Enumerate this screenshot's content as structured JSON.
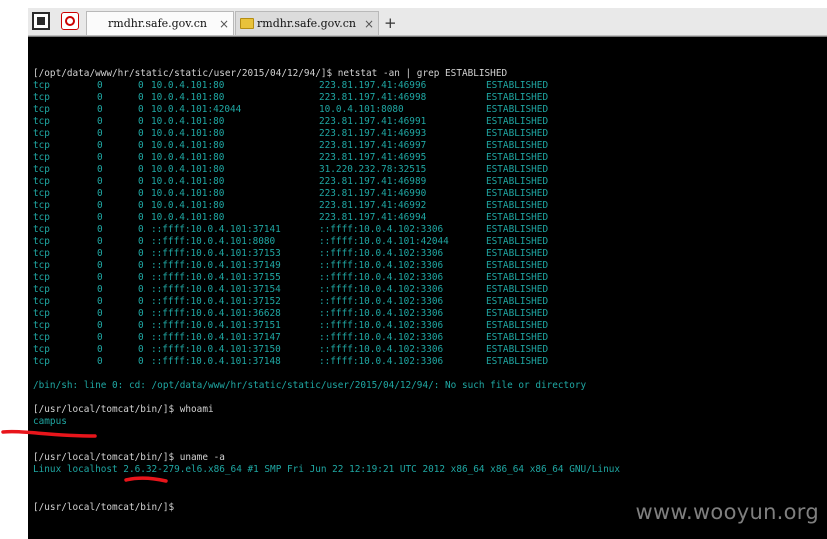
{
  "browser": {
    "tabs": [
      {
        "label": "rmdhr.safe.gov.cn",
        "active": true,
        "icon": "terminal-icon"
      },
      {
        "label": "rmdhr.safe.gov.cn",
        "active": false,
        "icon": "folder-icon"
      }
    ],
    "close_glyph": "×",
    "new_tab_glyph": "+"
  },
  "terminal": {
    "netstat_prompt": "[/opt/data/www/hr/static/static/user/2015/04/12/94/]$ netstat -an | grep ESTABLISHED",
    "connections": [
      [
        "tcp",
        "0",
        "0",
        "10.0.4.101:80",
        "223.81.197.41:46996",
        "ESTABLISHED"
      ],
      [
        "tcp",
        "0",
        "0",
        "10.0.4.101:80",
        "223.81.197.41:46998",
        "ESTABLISHED"
      ],
      [
        "tcp",
        "0",
        "0",
        "10.0.4.101:42044",
        "10.0.4.101:8080",
        "ESTABLISHED"
      ],
      [
        "tcp",
        "0",
        "0",
        "10.0.4.101:80",
        "223.81.197.41:46991",
        "ESTABLISHED"
      ],
      [
        "tcp",
        "0",
        "0",
        "10.0.4.101:80",
        "223.81.197.41:46993",
        "ESTABLISHED"
      ],
      [
        "tcp",
        "0",
        "0",
        "10.0.4.101:80",
        "223.81.197.41:46997",
        "ESTABLISHED"
      ],
      [
        "tcp",
        "0",
        "0",
        "10.0.4.101:80",
        "223.81.197.41:46995",
        "ESTABLISHED"
      ],
      [
        "tcp",
        "0",
        "0",
        "10.0.4.101:80",
        "31.220.232.78:32515",
        "ESTABLISHED"
      ],
      [
        "tcp",
        "0",
        "0",
        "10.0.4.101:80",
        "223.81.197.41:46989",
        "ESTABLISHED"
      ],
      [
        "tcp",
        "0",
        "0",
        "10.0.4.101:80",
        "223.81.197.41:46990",
        "ESTABLISHED"
      ],
      [
        "tcp",
        "0",
        "0",
        "10.0.4.101:80",
        "223.81.197.41:46992",
        "ESTABLISHED"
      ],
      [
        "tcp",
        "0",
        "0",
        "10.0.4.101:80",
        "223.81.197.41:46994",
        "ESTABLISHED"
      ],
      [
        "tcp",
        "0",
        "0",
        "::ffff:10.0.4.101:37141",
        "::ffff:10.0.4.102:3306",
        "ESTABLISHED"
      ],
      [
        "tcp",
        "0",
        "0",
        "::ffff:10.0.4.101:8080",
        "::ffff:10.0.4.101:42044",
        "ESTABLISHED"
      ],
      [
        "tcp",
        "0",
        "0",
        "::ffff:10.0.4.101:37153",
        "::ffff:10.0.4.102:3306",
        "ESTABLISHED"
      ],
      [
        "tcp",
        "0",
        "0",
        "::ffff:10.0.4.101:37149",
        "::ffff:10.0.4.102:3306",
        "ESTABLISHED"
      ],
      [
        "tcp",
        "0",
        "0",
        "::ffff:10.0.4.101:37155",
        "::ffff:10.0.4.102:3306",
        "ESTABLISHED"
      ],
      [
        "tcp",
        "0",
        "0",
        "::ffff:10.0.4.101:37154",
        "::ffff:10.0.4.102:3306",
        "ESTABLISHED"
      ],
      [
        "tcp",
        "0",
        "0",
        "::ffff:10.0.4.101:37152",
        "::ffff:10.0.4.102:3306",
        "ESTABLISHED"
      ],
      [
        "tcp",
        "0",
        "0",
        "::ffff:10.0.4.101:36628",
        "::ffff:10.0.4.102:3306",
        "ESTABLISHED"
      ],
      [
        "tcp",
        "0",
        "0",
        "::ffff:10.0.4.101:37151",
        "::ffff:10.0.4.102:3306",
        "ESTABLISHED"
      ],
      [
        "tcp",
        "0",
        "0",
        "::ffff:10.0.4.101:37147",
        "::ffff:10.0.4.102:3306",
        "ESTABLISHED"
      ],
      [
        "tcp",
        "0",
        "0",
        "::ffff:10.0.4.101:37150",
        "::ffff:10.0.4.102:3306",
        "ESTABLISHED"
      ],
      [
        "tcp",
        "0",
        "0",
        "::ffff:10.0.4.101:37148",
        "::ffff:10.0.4.102:3306",
        "ESTABLISHED"
      ]
    ],
    "error_line": "/bin/sh: line 0: cd: /opt/data/www/hr/static/static/user/2015/04/12/94/: No such file or directory",
    "whoami_prompt": "[/usr/local/tomcat/bin/]$ whoami",
    "whoami_output": "campus",
    "uname_prompt": "[/usr/local/tomcat/bin/]$ uname -a",
    "uname_output": "Linux localhost 2.6.32-279.el6.x86_64 #1 SMP Fri Jun 22 12:19:21 UTC 2012 x86_64 x86_64 x86_64 GNU/Linux",
    "final_prompt": "[/usr/local/tomcat/bin/]$"
  },
  "watermark": "www.wooyun.org",
  "colors": {
    "terminal_bg": "#000000",
    "terminal_text": "#1fa7a3",
    "prompt_text": "#d2d2d2",
    "annotation": "#e8151b"
  }
}
